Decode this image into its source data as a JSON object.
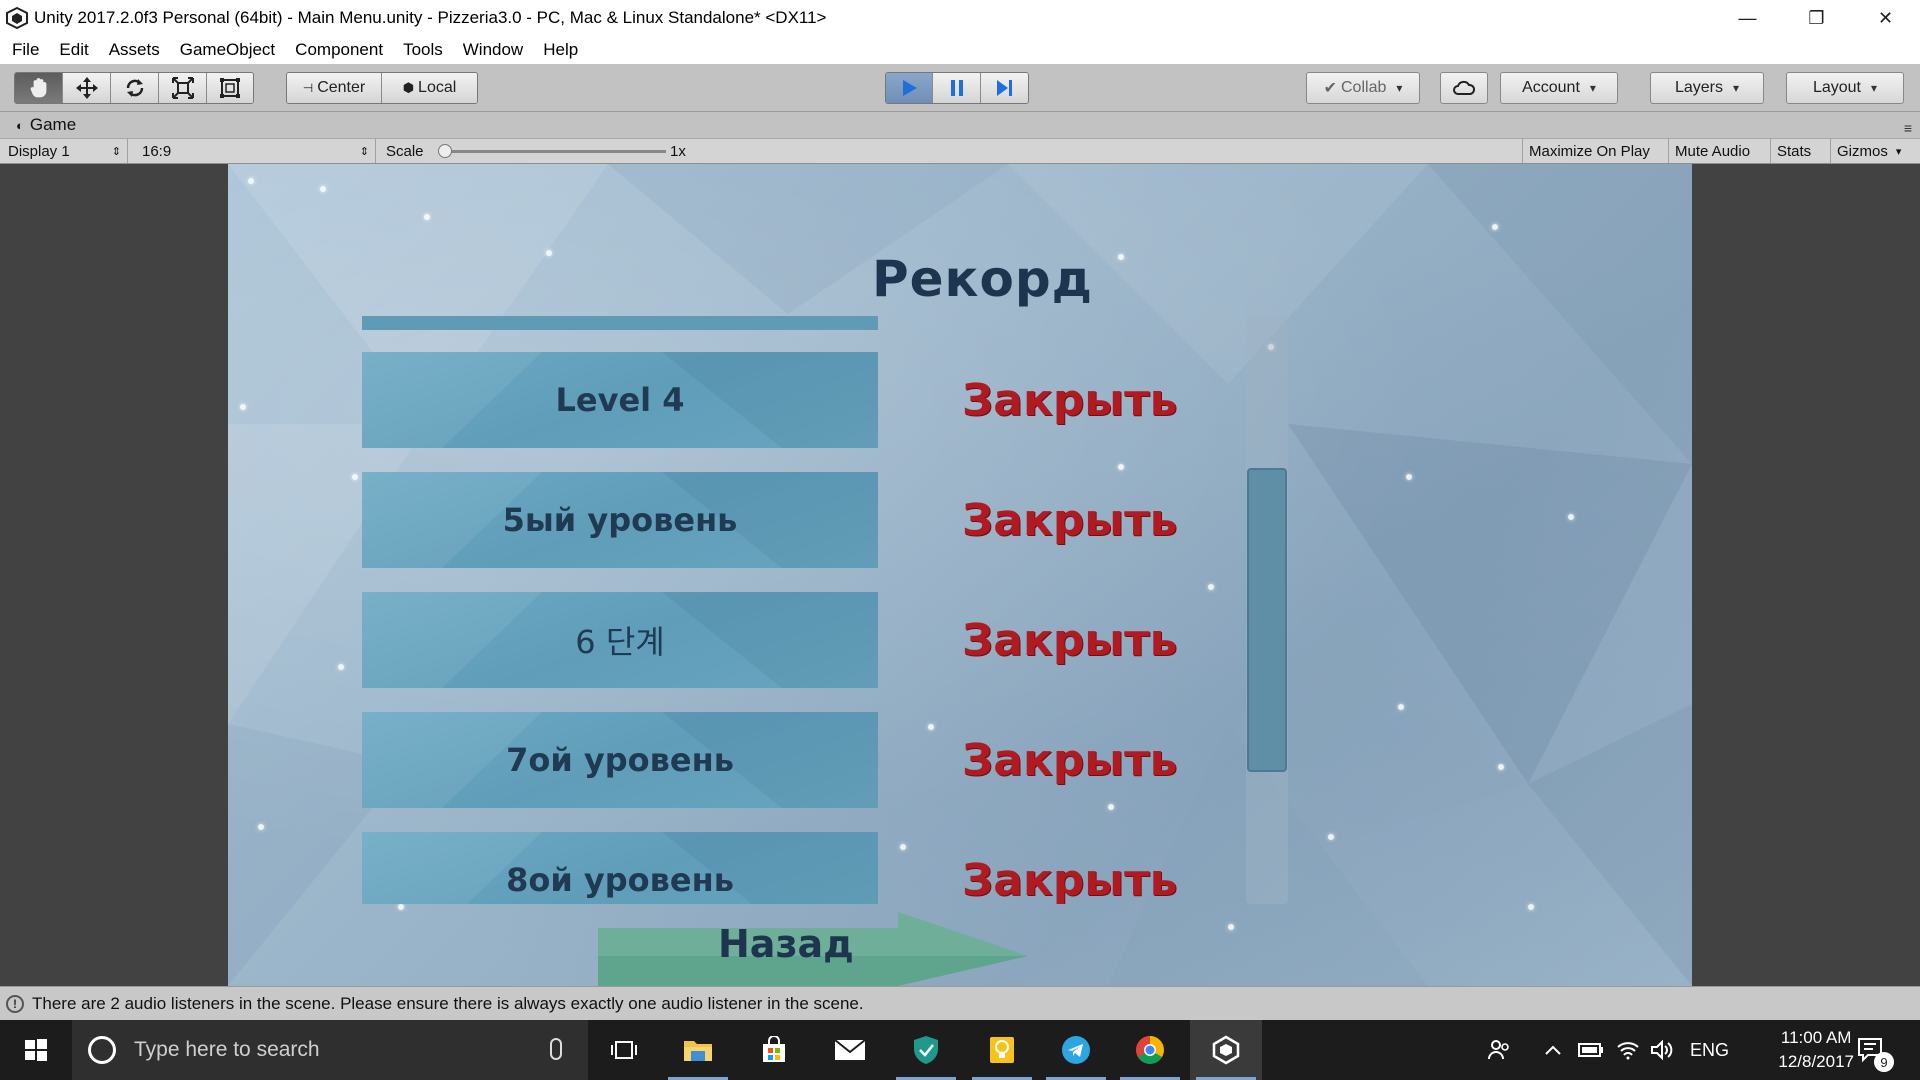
{
  "window": {
    "title": "Unity 2017.2.0f3 Personal (64bit) - Main Menu.unity - Pizzeria3.0 - PC, Mac & Linux Standalone* <DX11>",
    "minimize": "—",
    "maximize": "❐",
    "close": "✕"
  },
  "menu": [
    "File",
    "Edit",
    "Assets",
    "GameObject",
    "Component",
    "Tools",
    "Window",
    "Help"
  ],
  "toolbar": {
    "pivot_label": "Center",
    "space_label": "Local",
    "collab_label": "Collab",
    "account_label": "Account",
    "layers_label": "Layers",
    "layout_label": "Layout"
  },
  "game_panel": {
    "tab_label": "Game",
    "display": "Display 1",
    "aspect": "16:9",
    "scale_label": "Scale",
    "scale_value": "1x",
    "scale_fraction": 0.0,
    "maximize_on_play": "Maximize On Play",
    "mute_audio": "Mute Audio",
    "stats": "Stats",
    "gizmos": "Gizmos"
  },
  "game": {
    "title": "Рекорд",
    "levels": [
      {
        "name": "Level 4",
        "status": "Закрыть"
      },
      {
        "name": "5ый уровень",
        "status": "Закрыть"
      },
      {
        "name": "6 단계",
        "status": "Закрыть"
      },
      {
        "name": "7ой уровень",
        "status": "Закрыть"
      },
      {
        "name": "8ой уровень",
        "status": "Закрыть"
      }
    ],
    "back_label": "Назад"
  },
  "status": {
    "message": "There are 2 audio listeners in the scene. Please ensure there is always exactly one audio listener in the scene."
  },
  "taskbar": {
    "search_placeholder": "Type here to search",
    "language": "ENG",
    "time": "11:00 AM",
    "date": "12/8/2017",
    "notifications": "9"
  },
  "colors": {
    "level_button": "#5f9db9",
    "close_text": "#b01b22",
    "title_text": "#1e3550",
    "play_active": "#6f8fb7"
  }
}
